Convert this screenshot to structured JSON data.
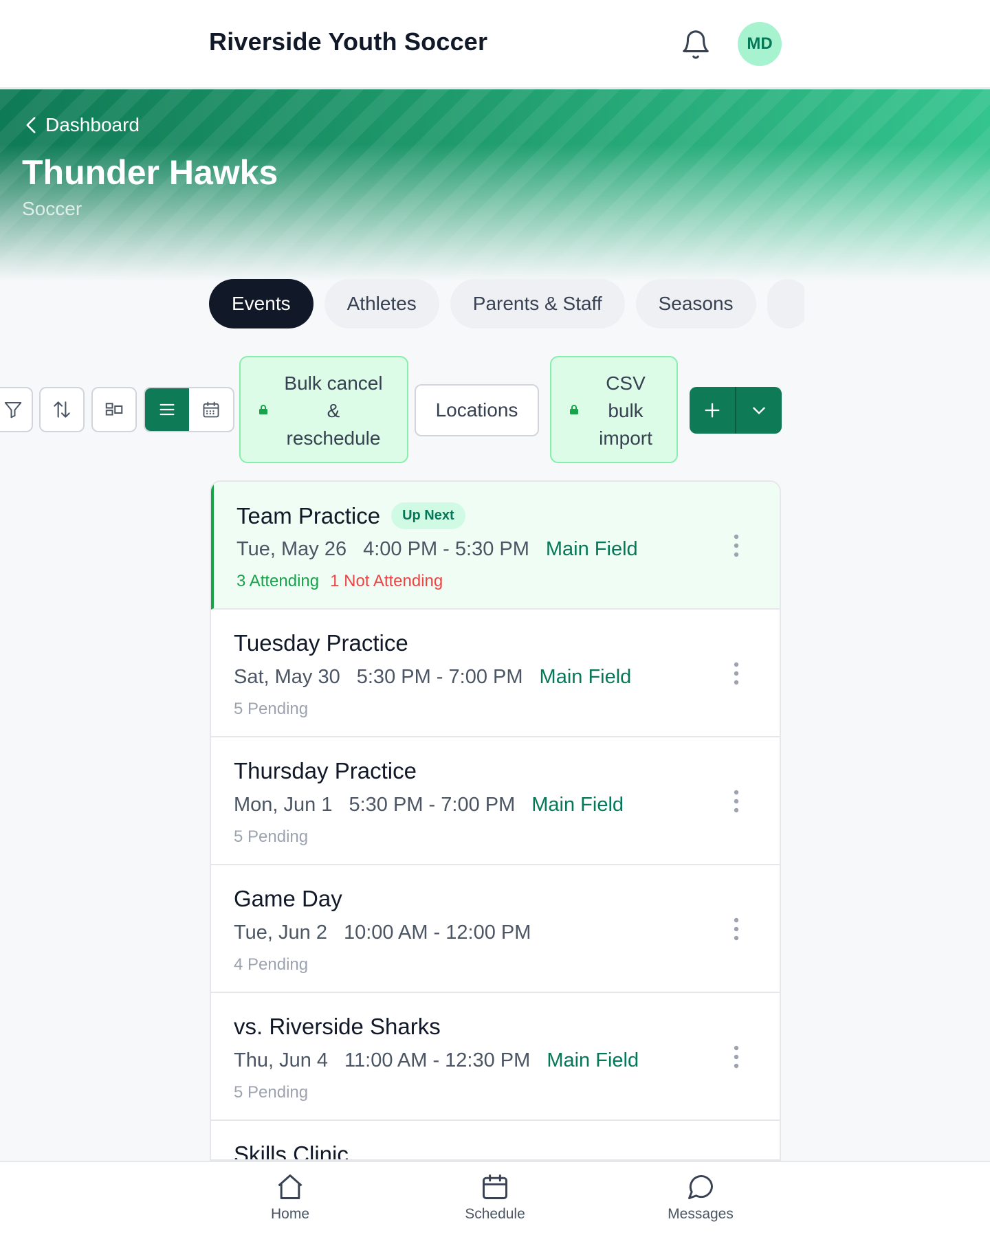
{
  "header": {
    "org_title": "Riverside Youth Soccer",
    "avatar_initials": "MD"
  },
  "hero": {
    "back_label": "Dashboard",
    "team_name": "Thunder Hawks",
    "sport": "Soccer"
  },
  "tabs": [
    {
      "label": "Events",
      "active": true
    },
    {
      "label": "Athletes",
      "active": false
    },
    {
      "label": "Parents & Staff",
      "active": false
    },
    {
      "label": "Seasons",
      "active": false
    }
  ],
  "toolbar": {
    "bulk_cancel_label": "Bulk cancel & reschedule",
    "locations_label": "Locations",
    "csv_import_label": "CSV bulk import",
    "view_mode": "list"
  },
  "events": [
    {
      "title": "Team Practice",
      "badge": "Up Next",
      "date": "Tue, May 26",
      "time": "4:00 PM - 5:30 PM",
      "location": "Main Field",
      "attending": "3 Attending",
      "not_attending": "1 Not Attending"
    },
    {
      "title": "Tuesday Practice",
      "date": "Sat, May 30",
      "time": "5:30 PM - 7:00 PM",
      "location": "Main Field",
      "pending": "5 Pending"
    },
    {
      "title": "Thursday Practice",
      "date": "Mon, Jun 1",
      "time": "5:30 PM - 7:00 PM",
      "location": "Main Field",
      "pending": "5 Pending"
    },
    {
      "title": "Game Day",
      "date": "Tue, Jun 2",
      "time": "10:00 AM - 12:00 PM",
      "location": "",
      "pending": "4 Pending"
    },
    {
      "title": "vs. Riverside Sharks",
      "date": "Thu, Jun 4",
      "time": "11:00 AM - 12:30 PM",
      "location": "Main Field",
      "pending": "5 Pending"
    },
    {
      "title": "Skills Clinic"
    }
  ],
  "bottom_nav": [
    {
      "label": "Home",
      "icon": "home-icon"
    },
    {
      "label": "Schedule",
      "icon": "calendar-icon"
    },
    {
      "label": "Messages",
      "icon": "chat-bubble-icon"
    }
  ],
  "colors": {
    "brand": "#0f7a56",
    "accent_light": "#dcfce7",
    "attending": "#16a34a",
    "not_attending": "#ef4444",
    "dark_tab": "#111827"
  }
}
